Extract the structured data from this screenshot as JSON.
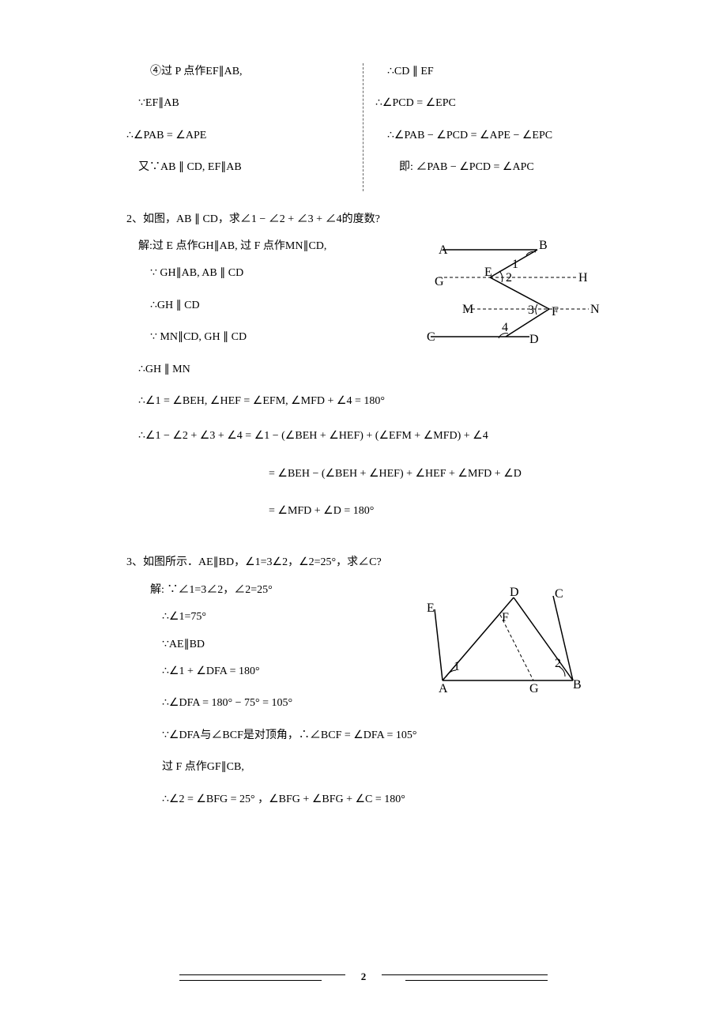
{
  "top": {
    "left": {
      "l1": "④过 P 点作EF∥AB,",
      "l2": "∵EF∥AB",
      "l3": "∴∠PAB = ∠APE",
      "l4": "又∵AB ∥ CD, EF∥AB"
    },
    "right": {
      "l1": "∴CD ∥ EF",
      "l2": "∴∠PCD = ∠EPC",
      "l3": "∴∠PAB − ∠PCD = ∠APE − ∠EPC",
      "l4": "即: ∠PAB − ∠PCD = ∠APC"
    }
  },
  "p2": {
    "title": "2、如图，AB ∥ CD，求∠1 − ∠2 + ∠3 + ∠4的度数?",
    "s1": "解:过 E 点作GH∥AB, 过 F 点作MN∥CD,",
    "s2": "∵ GH∥AB, AB ∥ CD",
    "s3": "∴GH ∥ CD",
    "s4": "∵ MN∥CD, GH ∥ CD",
    "s5": "∴GH ∥ MN",
    "s6": "∴∠1 = ∠BEH, ∠HEF = ∠EFM, ∠MFD + ∠4 = 180°",
    "s7": "∴∠1 − ∠2 + ∠3 + ∠4 = ∠1 − (∠BEH + ∠HEF) + (∠EFM + ∠MFD) + ∠4",
    "s8": "= ∠BEH − (∠BEH + ∠HEF) + ∠HEF + ∠MFD + ∠D",
    "s9": "= ∠MFD + ∠D = 180°",
    "diagram": {
      "A": "A",
      "B": "B",
      "G": "G",
      "H": "H",
      "M": "M",
      "N": "N",
      "C": "C",
      "D": "D",
      "E": "E",
      "F": "F",
      "n1": "1",
      "n2": "2",
      "n3": "3",
      "n4": "4"
    }
  },
  "p3": {
    "title": "3、如图所示．AE∥BD，∠1=3∠2，∠2=25°，求∠C?",
    "s1": "解: ∵∠1=3∠2，∠2=25°",
    "s2": "∴∠1=75°",
    "s3": "∵AE∥BD",
    "s4": "∴∠1 + ∠DFA = 180°",
    "s5": "∴∠DFA = 180° − 75° = 105°",
    "s6": "∵∠DFA与∠BCF是对顶角，∴∠BCF = ∠DFA = 105°",
    "s7": "过 F 点作GF∥CB,",
    "s8": "∴∠2 = ∠BFG = 25° ，∠BFG + ∠BFG + ∠C = 180°",
    "diagram": {
      "A": "A",
      "B": "B",
      "C": "C",
      "D": "D",
      "E": "E",
      "F": "F",
      "G": "G",
      "n1": "1",
      "n2": "2"
    }
  },
  "footer": {
    "page": "2"
  }
}
